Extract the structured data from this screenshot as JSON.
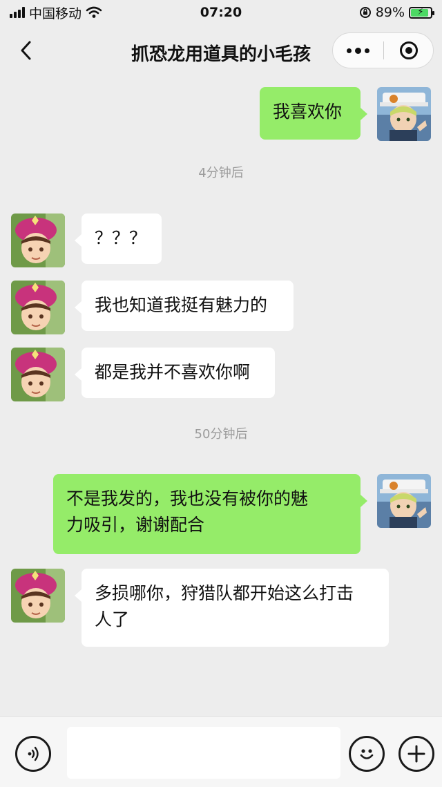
{
  "status_bar": {
    "carrier": "中国移动",
    "time": "07:20",
    "battery": "89%",
    "battery_level": 0.89
  },
  "nav": {
    "title": "抓恐龙用道具的小毛孩",
    "back_icon": "chevron-left-icon",
    "more_icon": "more-dots-icon",
    "close_icon": "target-close-icon"
  },
  "messages": [
    {
      "side": "out",
      "text": "我喜欢你"
    },
    {
      "side": "in",
      "text": "？？？"
    },
    {
      "side": "in",
      "text": "我也知道我挺有魅力的"
    },
    {
      "side": "in",
      "text": "都是我并不喜欢你啊"
    },
    {
      "side": "out",
      "line1": "不是我发的，我也没有被你的魅",
      "line2": "力吸引，谢谢配合"
    },
    {
      "side": "in",
      "line1": "多损哪你，狩猎队都开始这么打击",
      "line2": "人了"
    }
  ],
  "timestamps": [
    "4分钟后",
    "50分钟后"
  ],
  "input_bar": {
    "placeholder": "",
    "voice_icon": "voice-icon",
    "emoji_icon": "emoji-icon",
    "plus_icon": "plus-icon"
  },
  "colors": {
    "background": "#ededed",
    "out_bubble": "#95ec69",
    "in_bubble": "#ffffff",
    "timestamp": "#9b9b9b"
  }
}
